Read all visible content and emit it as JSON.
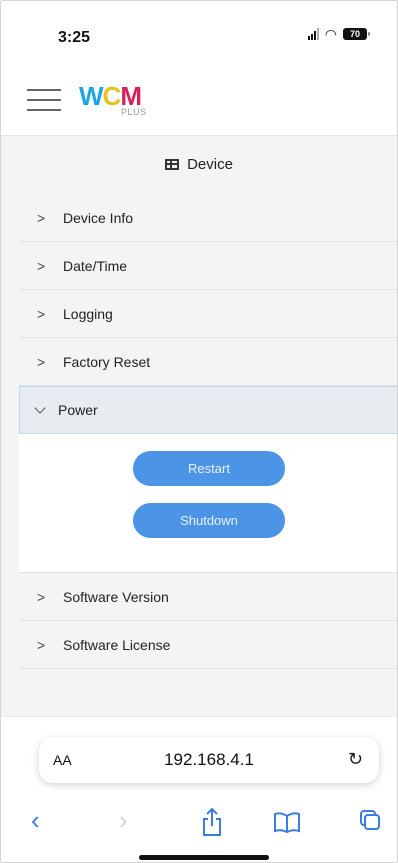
{
  "status_bar": {
    "time": "3:25",
    "battery": "70"
  },
  "app": {
    "logo": {
      "main_w": "W",
      "main_c": "C",
      "main_m": "M",
      "sub": "PLUS"
    }
  },
  "section": {
    "title": "Device"
  },
  "menu": {
    "items": [
      {
        "label": "Device Info"
      },
      {
        "label": "Date/Time"
      },
      {
        "label": "Logging"
      },
      {
        "label": "Factory Reset"
      },
      {
        "label": "Power"
      },
      {
        "label": "Software Version"
      },
      {
        "label": "Software License"
      }
    ],
    "power_actions": {
      "restart": "Restart",
      "shutdown": "Shutdown"
    }
  },
  "browser": {
    "text_size_label": "AA",
    "url": "192.168.4.1"
  },
  "colors": {
    "accent": "#4b94e6",
    "logo_w": "#1aa6e0",
    "logo_c": "#e8c21a",
    "logo_m": "#d81e5b"
  }
}
